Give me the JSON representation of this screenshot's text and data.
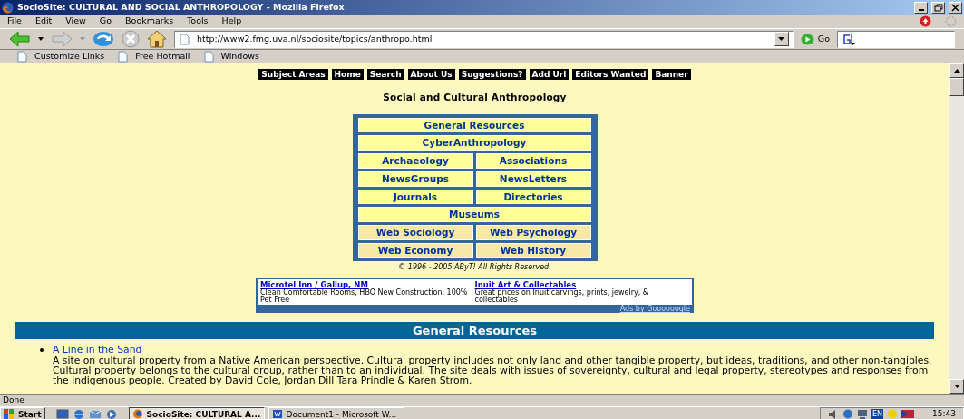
{
  "window": {
    "title": "SocioSite: CULTURAL AND SOCIAL ANTHROPOLOGY - Mozilla Firefox"
  },
  "menu": [
    "File",
    "Edit",
    "View",
    "Go",
    "Bookmarks",
    "Tools",
    "Help"
  ],
  "toolbar": {
    "url": "http://www2.fmg.uva.nl/sociosite/topics/anthropo.html",
    "go_label": "Go"
  },
  "bookmarks": [
    "Customize Links",
    "Free Hotmail",
    "Windows"
  ],
  "page": {
    "nav_buttons": [
      "Subject Areas",
      "Home",
      "Search",
      "About Us",
      "Suggestions?",
      "Add Url",
      "Editors Wanted",
      "Banner"
    ],
    "heading": "Social and Cultural Anthropology",
    "topic_rows": [
      [
        {
          "label": "General Resources",
          "color": "#ffff99"
        }
      ],
      [
        {
          "label": "CyberAnthropology",
          "color": "#ffff99"
        }
      ],
      [
        {
          "label": "Archaeology",
          "color": "#ffff99"
        },
        {
          "label": "Associations",
          "color": "#ffff99"
        }
      ],
      [
        {
          "label": "NewsGroups",
          "color": "#ffff99"
        },
        {
          "label": "NewsLetters",
          "color": "#ffff99"
        }
      ],
      [
        {
          "label": "Journals",
          "color": "#ffff99"
        },
        {
          "label": "Directories",
          "color": "#ffff99"
        }
      ],
      [
        {
          "label": "Museums",
          "color": "#ffff99"
        }
      ],
      [
        {
          "label": "Web Sociology",
          "color": "#f8e8a8"
        },
        {
          "label": "Web Psychology",
          "color": "#f8e8a8"
        }
      ],
      [
        {
          "label": "Web Economy",
          "color": "#f8e8a8"
        },
        {
          "label": "Web History",
          "color": "#f8e8a8"
        }
      ]
    ],
    "copyright": "© 1996 - 2005 AByT! All Rights Reserved.",
    "ads": [
      {
        "title": "Microtel Inn / Gallup, NM",
        "text": "Clean Comfortable Rooms, HBO New Construction, 100% Pet Free"
      },
      {
        "title": "Inuit Art & Collectables",
        "text": "Great prices on Inuit carvings, prints, jewelry, & collectables"
      }
    ],
    "ads_footer": "Ads by Goooooogle",
    "section_title": "General Resources",
    "entries": [
      {
        "title": "A Line in the Sand",
        "description": "A site on cultural property from a Native American perspective. Cultural property includes not only land and other tangible property, but ideas, traditions, and other non-tangibles. Cultural property belongs to the cultural group, rather than to an individual. The site deals with issues of sovereignty, cultural and legal property, stereotypes and responses from the indigenous people. Created by David Cole, Jordan Dill Tara Prindle & Karen Strom."
      }
    ]
  },
  "status_bar": "Done",
  "taskbar": {
    "start": "Start",
    "tasks": [
      {
        "label": "SocioSite: CULTURAL A...",
        "selected": true
      },
      {
        "label": "Document1 - Microsoft W...",
        "selected": false
      }
    ],
    "language": "EN",
    "clock": "15:43"
  }
}
